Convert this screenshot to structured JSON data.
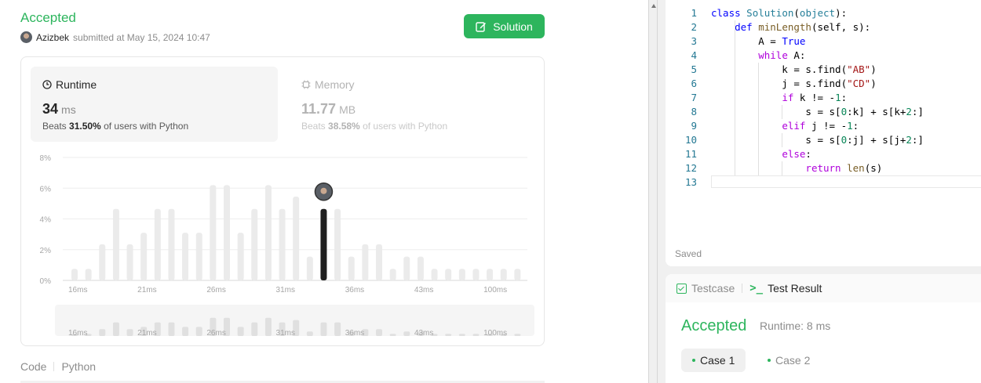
{
  "submission": {
    "status": "Accepted",
    "username": "Azizbek",
    "submitted_text": "submitted at May 15, 2024 10:47",
    "solution_button": "Solution"
  },
  "runtime": {
    "title": "Runtime",
    "value": "34",
    "unit": "ms",
    "beats_prefix": "Beats",
    "beats_pct": "31.50%",
    "beats_suffix": "of users with Python"
  },
  "memory": {
    "title": "Memory",
    "value": "11.77",
    "unit": "MB",
    "beats_prefix": "Beats",
    "beats_pct": "38.58%",
    "beats_suffix": "of users with Python"
  },
  "chart_data": {
    "type": "bar",
    "y_ticks": [
      "8%",
      "6%",
      "4%",
      "2%",
      "0%"
    ],
    "ylim": [
      0,
      8
    ],
    "x_tick_labels": [
      "16ms",
      "21ms",
      "26ms",
      "31ms",
      "36ms",
      "43ms",
      "100ms"
    ],
    "values": [
      0.75,
      0.75,
      2.35,
      4.65,
      2.35,
      3.1,
      4.65,
      4.65,
      3.1,
      3.1,
      6.2,
      6.2,
      3.1,
      4.65,
      6.2,
      4.65,
      5.45,
      1.55,
      4.65,
      4.65,
      1.55,
      2.35,
      2.35,
      0.75,
      1.55,
      1.55,
      0.75,
      0.75,
      0.75,
      0.75,
      0.75,
      0.75,
      0.75
    ],
    "highlight_index": 18,
    "colors": {
      "bar": "#ebebeb",
      "highlight": "#1f1f1f",
      "grid": "#ededed",
      "axis": "#d9d9d9",
      "tick_text": "#a6a6a6"
    }
  },
  "bottom_tabs": [
    "Code",
    "Python"
  ],
  "editor": {
    "saved_label": "Saved",
    "lines": [
      "class Solution(object):",
      "    def minLength(self, s):",
      "        A = True",
      "        while A:",
      "            k = s.find(\"AB\")",
      "            j = s.find(\"CD\")",
      "            if k != -1:",
      "                s = s[0:k] + s[k+2:]",
      "            elif j != -1:",
      "                s = s[0:j] + s[j+2:]",
      "            else:",
      "                return len(s)",
      ""
    ]
  },
  "test_panel": {
    "tab_testcase": "Testcase",
    "tab_result": "Test Result",
    "status": "Accepted",
    "runtime": "Runtime: 8 ms",
    "cases": [
      "Case 1",
      "Case 2"
    ]
  }
}
